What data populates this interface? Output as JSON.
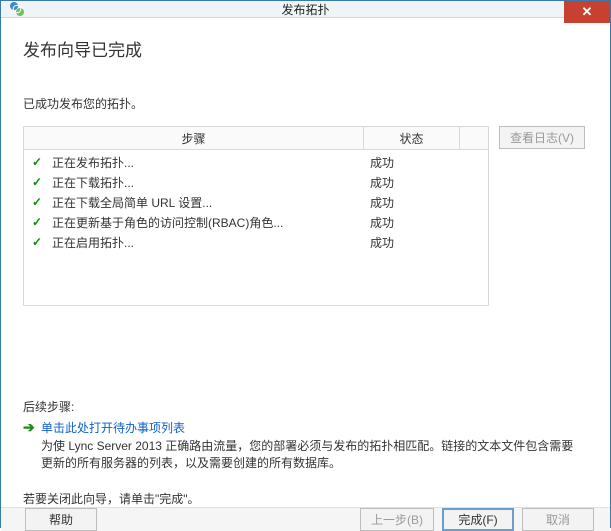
{
  "window": {
    "title": "发布拓扑",
    "close_glyph": "✕"
  },
  "heading": "发布向导已完成",
  "intro": "已成功发布您的拓扑。",
  "columns": {
    "step": "步骤",
    "state": "状态"
  },
  "steps": [
    {
      "label": "正在发布拓扑...",
      "state": "成功"
    },
    {
      "label": "正在下载拓扑...",
      "state": "成功"
    },
    {
      "label": "正在下载全局简单 URL 设置...",
      "state": "成功"
    },
    {
      "label": "正在更新基于角色的访问控制(RBAC)角色...",
      "state": "成功"
    },
    {
      "label": "正在启用拓扑...",
      "state": "成功"
    }
  ],
  "logs_button": "查看日志(V)",
  "after": {
    "label": "后续步骤:",
    "link": "单击此处打开待办事项列表",
    "desc": "为使 Lync Server 2013 正确路由流量，您的部署必须与发布的拓扑相匹配。链接的文本文件包含需要更新的所有服务器的列表，以及需要创建的所有数据库。"
  },
  "close_note": "若要关闭此向导，请单击\"完成\"。",
  "footer": {
    "help": "帮助",
    "back": "上一步(B)",
    "finish": "完成(F)",
    "cancel": "取消"
  },
  "check_glyph": "✓",
  "arrow_glyph": "➔"
}
